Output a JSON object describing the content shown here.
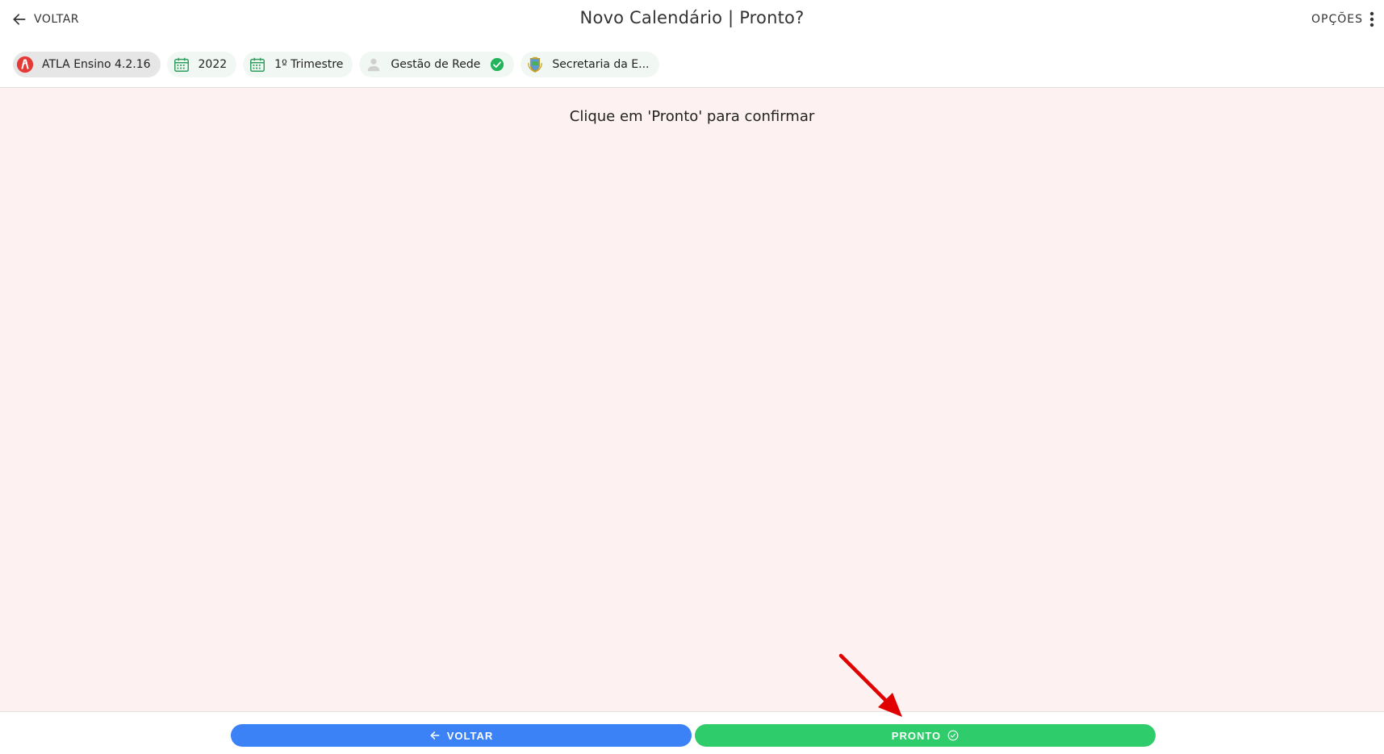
{
  "header": {
    "back_label": "VOLTAR",
    "title": "Novo Calendário | Pronto?",
    "options_label": "OPÇÕES"
  },
  "chips": [
    {
      "label": "ATLA Ensino 4.2.16",
      "icon": "atla-logo-icon"
    },
    {
      "label": "2022",
      "icon": "calendar-icon"
    },
    {
      "label": "1º Trimestre",
      "icon": "calendar-icon"
    },
    {
      "label": "Gestão de Rede",
      "icon": "user-icon",
      "status_icon": "check-circle-icon"
    },
    {
      "label": "Secretaria da E...",
      "icon": "crest-icon"
    }
  ],
  "main": {
    "instruction": "Clique em 'Pronto' para confirmar"
  },
  "footer": {
    "back_label": "VOLTAR",
    "ready_label": "PRONTO"
  },
  "colors": {
    "content_bg": "#fdf1f1",
    "chip_bg": "#f1f8f3",
    "primary_blue": "#3b82f6",
    "success_green": "#2ecc6a",
    "logo_red": "#e53935",
    "annotation_red": "#e00000"
  }
}
